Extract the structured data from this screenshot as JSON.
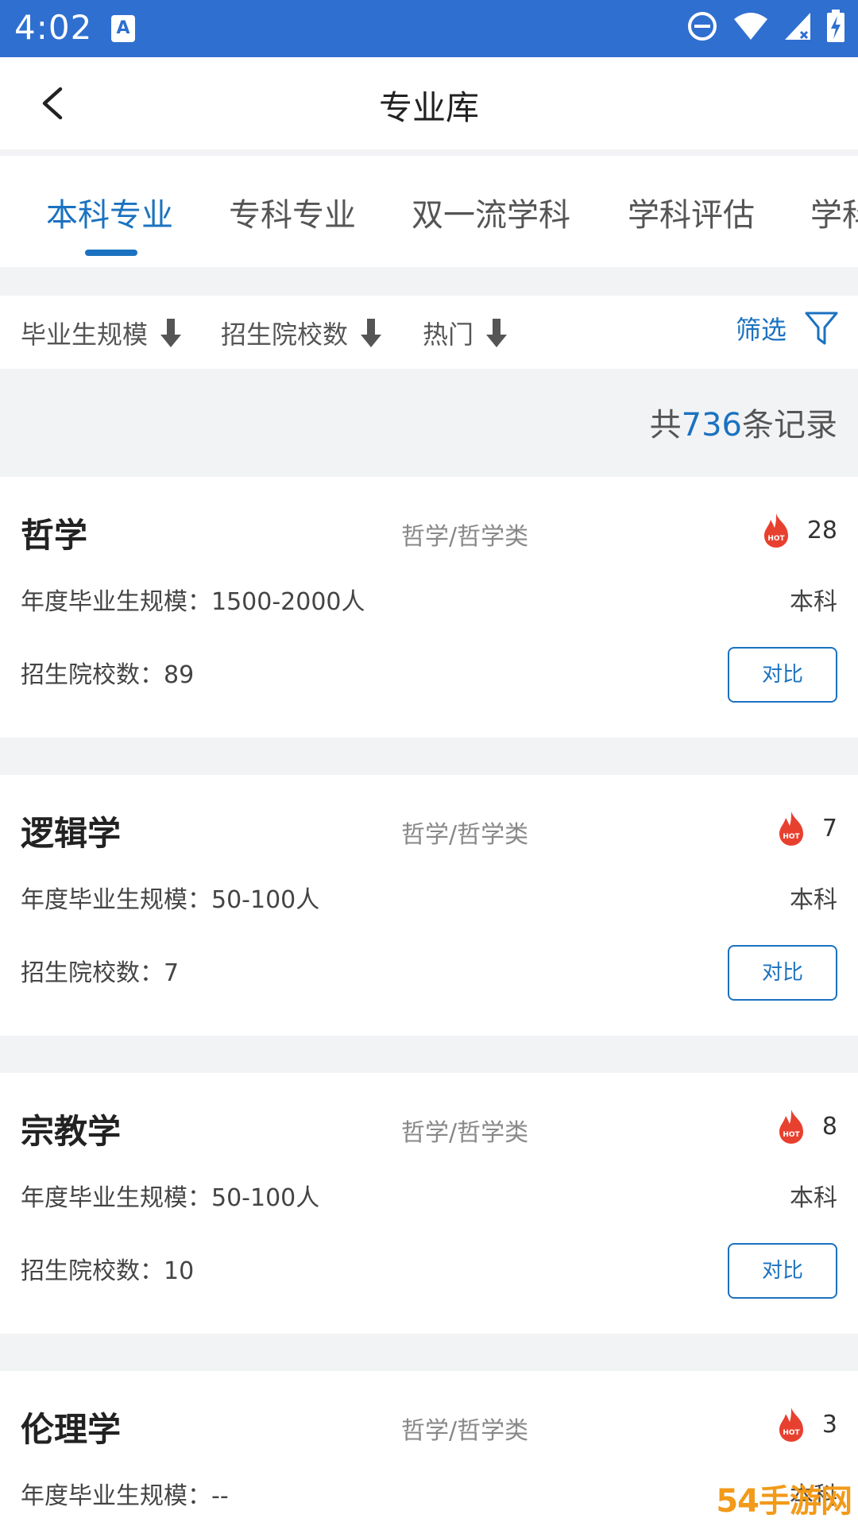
{
  "status_bar": {
    "time": "4:02",
    "app_icon_letter": "A"
  },
  "header": {
    "title": "专业库"
  },
  "tabs": [
    {
      "label": "本科专业",
      "active": true
    },
    {
      "label": "专科专业",
      "active": false
    },
    {
      "label": "双一流学科",
      "active": false
    },
    {
      "label": "学科评估",
      "active": false
    },
    {
      "label": "学科",
      "active": false
    }
  ],
  "sort_bar": {
    "items": [
      "毕业生规模",
      "招生院校数",
      "热门"
    ],
    "filter_label": "筛选"
  },
  "count": {
    "prefix": "共",
    "number": "736",
    "suffix": "条记录"
  },
  "cards": [
    {
      "name": "哲学",
      "category": "哲学/哲学类",
      "hot": "28",
      "grad": "年度毕业生规模：1500-2000人",
      "level": "本科",
      "schools": "招生院校数：89",
      "compare": "对比"
    },
    {
      "name": "逻辑学",
      "category": "哲学/哲学类",
      "hot": "7",
      "grad": "年度毕业生规模：50-100人",
      "level": "本科",
      "schools": "招生院校数：7",
      "compare": "对比"
    },
    {
      "name": "宗教学",
      "category": "哲学/哲学类",
      "hot": "8",
      "grad": "年度毕业生规模：50-100人",
      "level": "本科",
      "schools": "招生院校数：10",
      "compare": "对比"
    },
    {
      "name": "伦理学",
      "category": "哲学/哲学类",
      "hot": "3",
      "grad": "年度毕业生规模：--",
      "level": "本科",
      "schools": "",
      "compare": ""
    }
  ],
  "hot_badge_text": "HOT",
  "watermark": "54手游网",
  "colors": {
    "accent": "#1b72c0",
    "status_bar": "#2f6fd0",
    "hot": "#e8402f"
  }
}
